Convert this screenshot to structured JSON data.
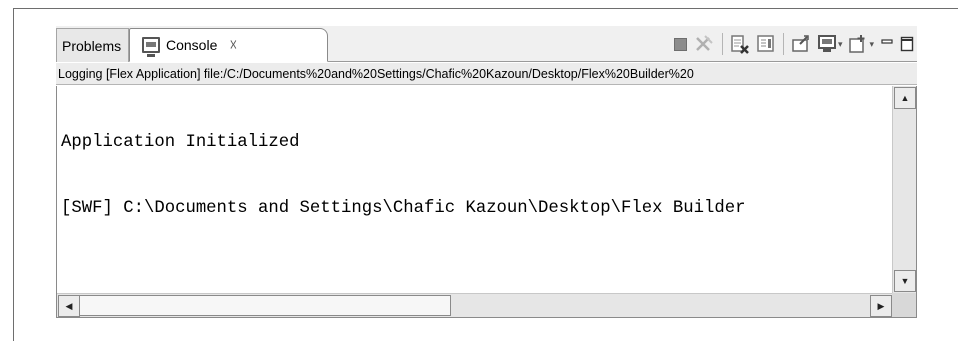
{
  "tabs": {
    "problems_label": "Problems",
    "console_label": "Console",
    "close_glyph": "☓"
  },
  "toolbar": {
    "icons": [
      "terminate-icon",
      "remove-launches-icon",
      "clear-console-icon",
      "scroll-lock-icon",
      "pin-console-icon",
      "display-console-icon",
      "open-console-icon",
      "minimize-icon",
      "maximize-icon"
    ],
    "dropdown_glyph": "▾"
  },
  "console": {
    "description": "Logging [Flex Application] file:/C:/Documents%20and%20Settings/Chafic%20Kazoun/Desktop/Flex%20Builder%20",
    "lines": [
      "Application Initialized",
      "[SWF] C:\\Documents and Settings\\Chafic Kazoun\\Desktop\\Flex Builder"
    ]
  }
}
